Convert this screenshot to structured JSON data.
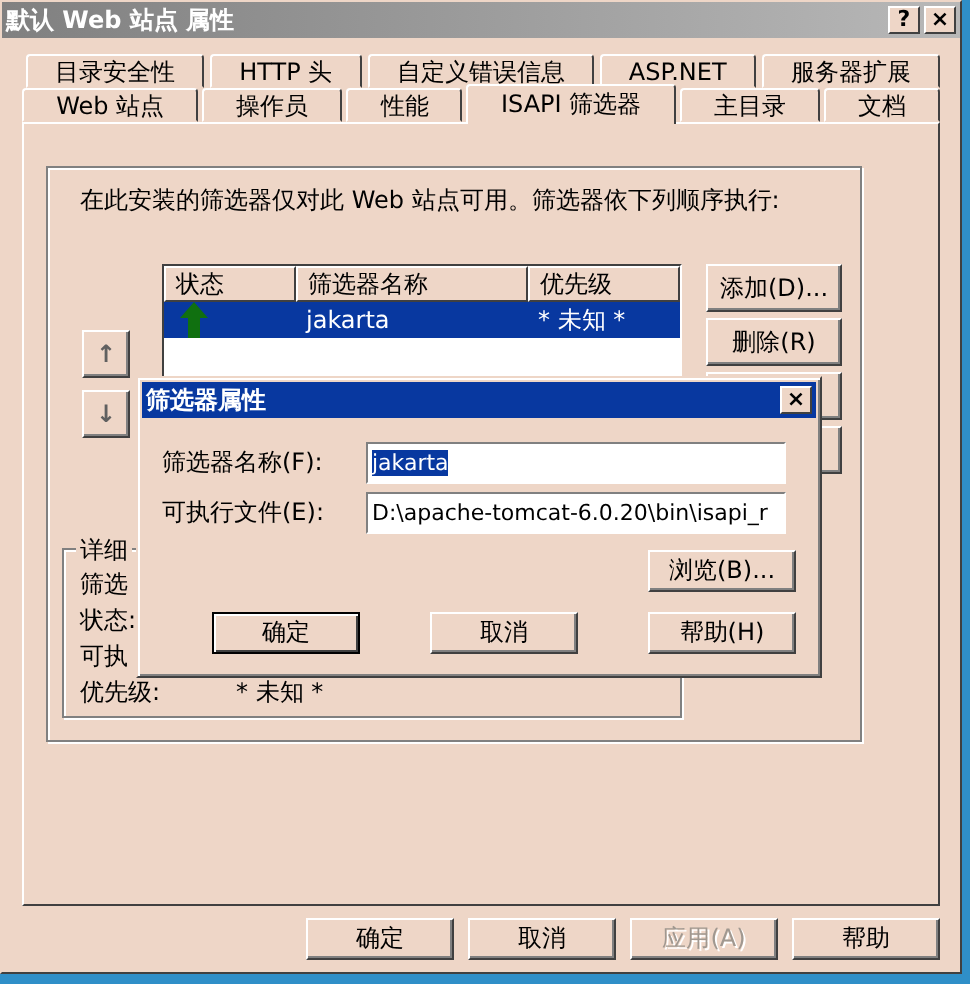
{
  "window": {
    "title": "默认 Web 站点 属性",
    "help_button": "?",
    "close_button": "×"
  },
  "tab_rows": [
    {
      "tabs": [
        {
          "label": "目录安全性",
          "selected": false
        },
        {
          "label": "HTTP 头",
          "selected": false
        },
        {
          "label": "自定义错误信息",
          "selected": false
        },
        {
          "label": "ASP.NET",
          "selected": false
        },
        {
          "label": "服务器扩展",
          "selected": false
        }
      ]
    },
    {
      "tabs": [
        {
          "label": "Web 站点",
          "selected": false
        },
        {
          "label": "操作员",
          "selected": false
        },
        {
          "label": "性能",
          "selected": false
        },
        {
          "label": "ISAPI 筛选器",
          "selected": true
        },
        {
          "label": "主目录",
          "selected": false
        },
        {
          "label": "文档",
          "selected": false
        }
      ]
    }
  ],
  "description": "在此安装的筛选器仅对此 Web 站点可用。筛选器依下列顺序执行:",
  "filter_table": {
    "columns": [
      "状态",
      "筛选器名称",
      "优先级"
    ],
    "rows": [
      {
        "kind": "loaded",
        "name": "jakarta",
        "priority": "* 未知 *",
        "selected": true
      }
    ]
  },
  "side_buttons": [
    "添加(D)...",
    "删除(R)"
  ],
  "order_buttons": [
    "↑",
    "↓"
  ],
  "details": {
    "title": "详细",
    "rows": [
      {
        "label": "筛选"
      },
      {
        "label": "状态:"
      },
      {
        "label": "可执"
      },
      {
        "label": "优先级:",
        "value": "* 未知 *"
      }
    ]
  },
  "dialog": {
    "title": "筛选器属性",
    "close_button": "×",
    "fields": [
      {
        "label": "筛选器名称(F):",
        "value": "jakarta",
        "selected": true
      },
      {
        "label": "可执行文件(E):",
        "value": "D:\\apache-tomcat-6.0.20\\bin\\isapi_r",
        "selected": false
      }
    ],
    "browse_button": "浏览(B)...",
    "buttons": [
      {
        "label": "确定",
        "default": true
      },
      {
        "label": "取消",
        "default": false
      },
      {
        "label": "帮助(H)",
        "default": false
      }
    ]
  },
  "buttons": [
    {
      "label": "确定",
      "disabled": false
    },
    {
      "label": "取消",
      "disabled": false
    },
    {
      "label": "应用(A)",
      "disabled": true
    },
    {
      "label": "帮助",
      "disabled": false
    }
  ]
}
